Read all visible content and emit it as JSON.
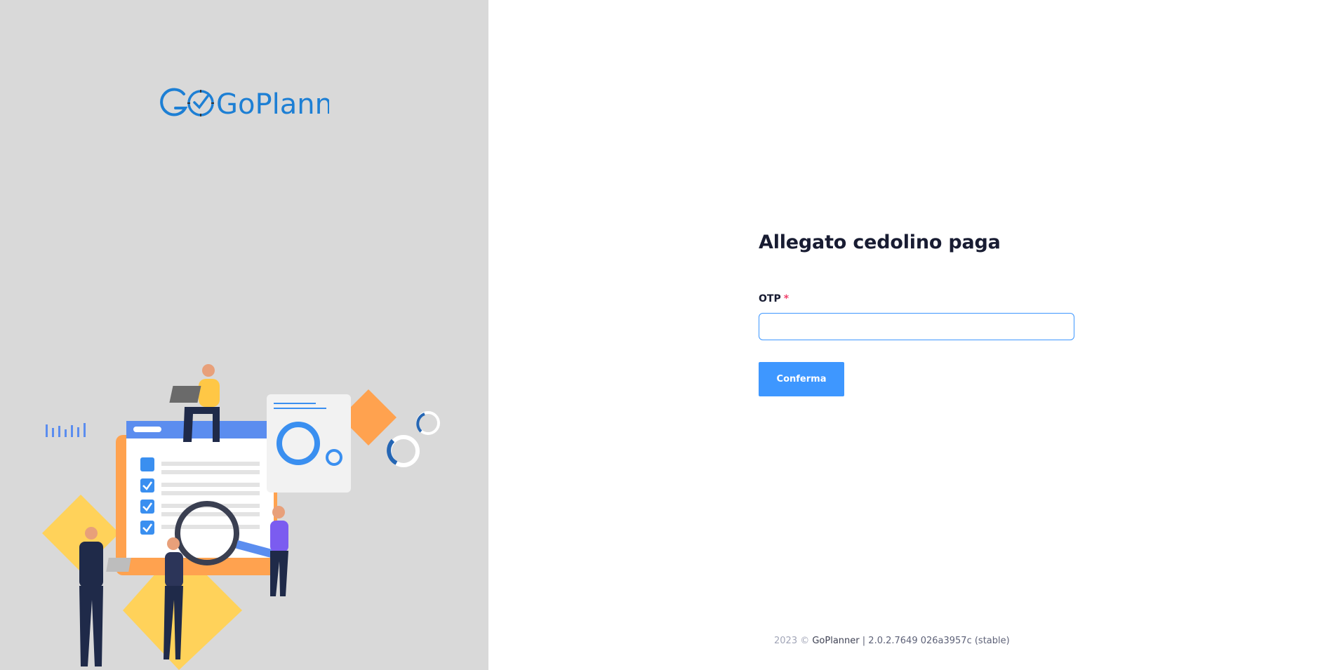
{
  "brand": {
    "logo_text": "GoPlanner"
  },
  "form": {
    "title": "Allegato cedolino paga",
    "otp_label": "OTP",
    "required_mark": "*",
    "otp_value": "",
    "submit_label": "Conferma"
  },
  "footer": {
    "year": "2023 ©",
    "brand": "GoPlanner",
    "version": "| 2.0.2.7649 026a3957c (stable)"
  },
  "colors": {
    "accent": "#3e97ff",
    "left_panel_bg": "#d9d9d9",
    "logo_blue": "#1d7fd4",
    "title": "#181c32",
    "required": "#f1416c"
  },
  "icons": [
    "goplanner-logo",
    "team-checklist-illustration"
  ]
}
